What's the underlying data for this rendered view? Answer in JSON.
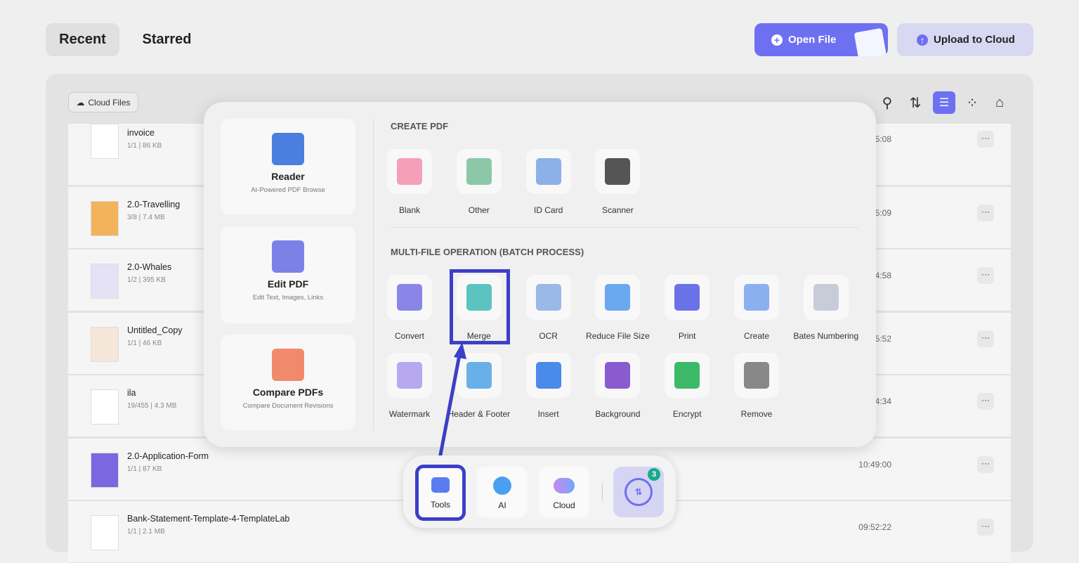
{
  "tabs": {
    "recent": "Recent",
    "starred": "Starred"
  },
  "actions": {
    "open_file": "Open File",
    "upload": "Upload to Cloud"
  },
  "toolbar": {
    "cloud_files": "Cloud Files"
  },
  "colors": {
    "accent": "#6e70f2",
    "highlight": "#3c3fc8",
    "badge": "#1aa98a"
  },
  "files": [
    {
      "name": "invoice",
      "meta": "1/1 | 86 KB",
      "time": "5:08",
      "thumb": "#fff"
    },
    {
      "name": "2.0-Travelling",
      "meta": "3/8 | 7.4 MB",
      "time": "5:09",
      "thumb": "#f2b35a"
    },
    {
      "name": "2.0-Whales",
      "meta": "1/2 | 395 KB",
      "time": "4:58",
      "thumb": "#e6e2f5"
    },
    {
      "name": "Untitled_Copy",
      "meta": "1/1 | 46 KB",
      "time": "5:52",
      "thumb": "#f5e6da"
    },
    {
      "name": "ila",
      "meta": "19/455 | 4.3 MB",
      "time": "4:34",
      "thumb": "#fff"
    },
    {
      "name": "2.0-Application-Form",
      "meta": "1/1 | 87 KB",
      "time": "10:49:00",
      "thumb": "#7b68e0"
    },
    {
      "name": "Bank-Statement-Template-4-TemplateLab",
      "meta": "1/1 | 2.1 MB",
      "time": "09:52:22",
      "thumb": "#fff"
    }
  ],
  "panel": {
    "cards": [
      {
        "title": "Reader",
        "sub": "AI-Powered PDF Browse",
        "color": "#4a7fe0"
      },
      {
        "title": "Edit PDF",
        "sub": "Edit Text, Images, Links",
        "color": "#7a82e8"
      },
      {
        "title": "Compare PDFs",
        "sub": "Compare Document Revisions",
        "color": "#f08a6a"
      }
    ],
    "create_title": "CREATE PDF",
    "create": [
      {
        "label": "Blank",
        "color": "#f3a0b8"
      },
      {
        "label": "Other",
        "color": "#8cc8a8"
      },
      {
        "label": "ID Card",
        "color": "#8eb0e8"
      },
      {
        "label": "Scanner",
        "color": "#555"
      }
    ],
    "batch_title": "MULTI-FILE OPERATION (BATCH PROCESS)",
    "batch": [
      {
        "label": "Convert",
        "color": "#8a86e8"
      },
      {
        "label": "Merge",
        "color": "#5bc4c0"
      },
      {
        "label": "OCR",
        "color": "#9ab8e8"
      },
      {
        "label": "Reduce File Size",
        "color": "#6aa8f0"
      },
      {
        "label": "Print",
        "color": "#6a72e8"
      },
      {
        "label": "Create",
        "color": "#8ab0f0"
      },
      {
        "label": "Bates Numbering",
        "color": "#c8ccd8"
      },
      {
        "label": "Watermark",
        "color": "#b8a8f0"
      },
      {
        "label": "Header & Footer",
        "color": "#6ab0e8"
      },
      {
        "label": "Insert",
        "color": "#4a8ae8"
      },
      {
        "label": "Background",
        "color": "#8a5ad0"
      },
      {
        "label": "Encrypt",
        "color": "#3cba6a"
      },
      {
        "label": "Remove",
        "color": "#888"
      }
    ]
  },
  "dock": {
    "tools": "Tools",
    "ai": "AI",
    "cloud": "Cloud",
    "sync_badge": "3"
  }
}
